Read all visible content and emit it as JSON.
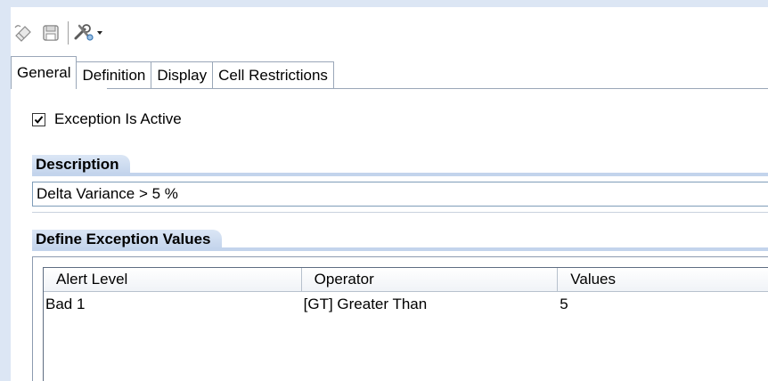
{
  "toolbar": {
    "buttons": [
      {
        "icon": "eraser-icon"
      },
      {
        "icon": "save-icon"
      },
      {
        "icon": "tools-icon",
        "has_dropdown": true
      }
    ]
  },
  "tabs": [
    {
      "label": "General",
      "active": true
    },
    {
      "label": "Definition",
      "active": false
    },
    {
      "label": "Display",
      "active": false
    },
    {
      "label": "Cell Restrictions",
      "active": false
    }
  ],
  "exception_active": {
    "label": "Exception Is Active",
    "checked": true
  },
  "description": {
    "header": "Description",
    "value": "Delta Variance > 5 %"
  },
  "define_values": {
    "header": "Define Exception Values",
    "columns": [
      "Alert Level",
      "Operator",
      "Values"
    ],
    "rows": [
      [
        "Bad 1",
        "[GT] Greater Than",
        "5"
      ]
    ]
  },
  "colors": {
    "header_gradient": "#c3d4ec",
    "frame": "#dce6f4"
  }
}
